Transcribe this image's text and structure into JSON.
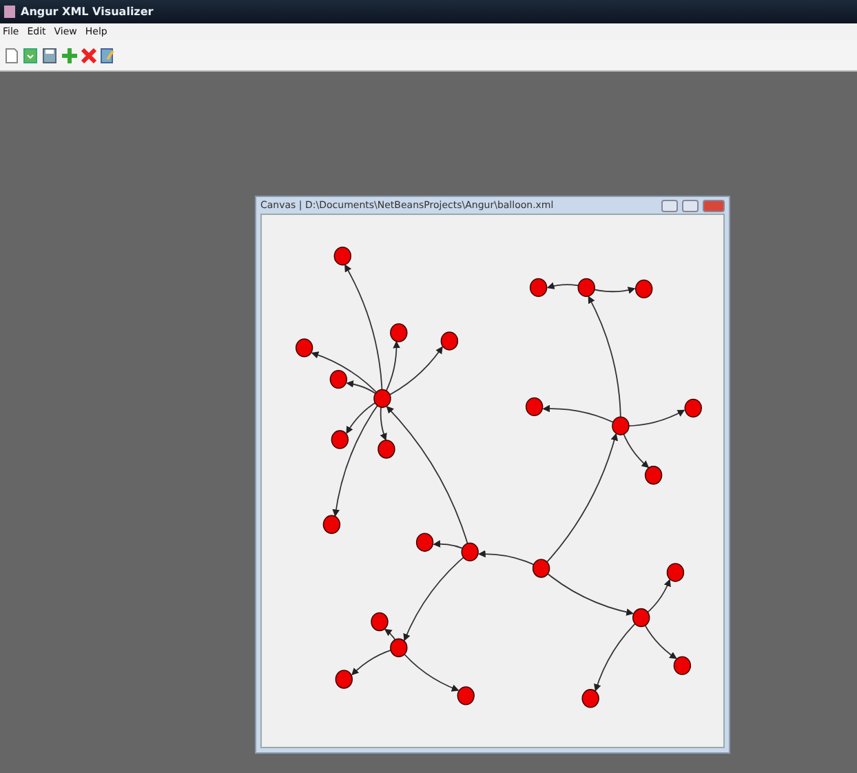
{
  "window": {
    "title": "Angur XML Visualizer"
  },
  "menu": [
    "File",
    "Edit",
    "View",
    "Help"
  ],
  "toolbar": [
    {
      "kind": "new"
    },
    {
      "kind": "open"
    },
    {
      "kind": "save"
    },
    {
      "kind": "add"
    },
    {
      "kind": "delete"
    },
    {
      "kind": "edit"
    }
  ],
  "canvas_window": {
    "title": "Canvas | D:\\Documents\\NetBeansProjects\\Angur\\balloon.xml"
  }
}
